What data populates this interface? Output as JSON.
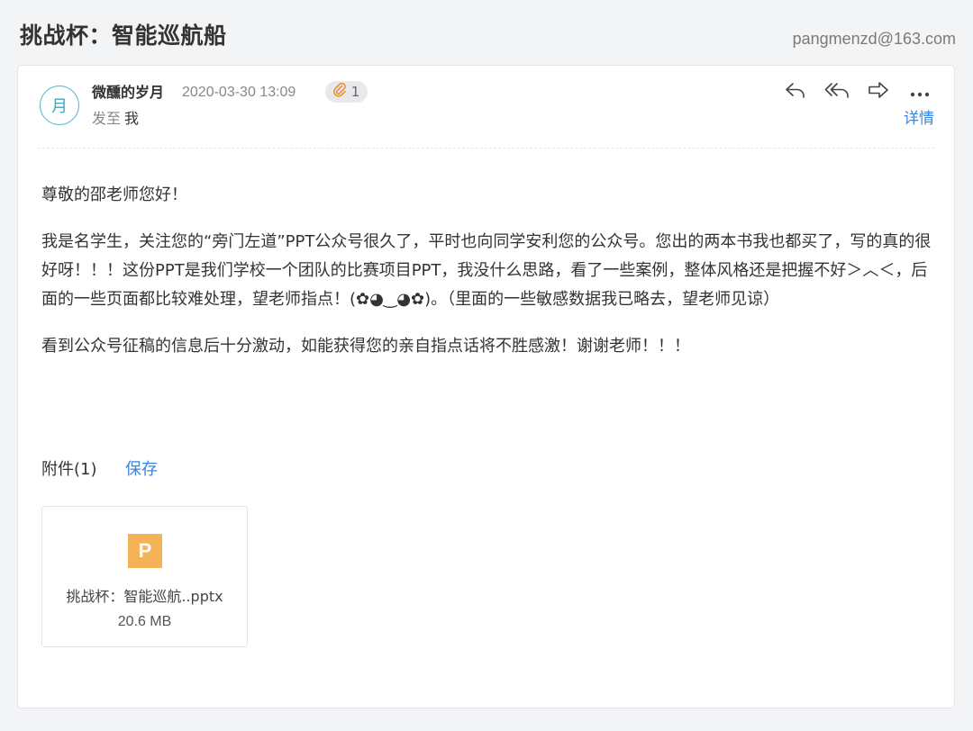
{
  "header": {
    "subject": "挑战杯：智能巡航船",
    "account": "pangmenzd@163.com"
  },
  "message": {
    "avatar_char": "月",
    "sender": "微醺的岁月",
    "date": "2020-03-30 13:09",
    "attachment_count": "1",
    "to_label": "发至",
    "to_value": "我",
    "detail_link": "详情",
    "actions": [
      {
        "name": "reply",
        "icon": "reply-icon"
      },
      {
        "name": "reply-all",
        "icon": "reply-all-icon"
      },
      {
        "name": "forward",
        "icon": "forward-icon"
      },
      {
        "name": "more",
        "icon": "more-icon"
      }
    ]
  },
  "body": {
    "paragraphs": [
      "尊敬的邵老师您好！",
      "我是名学生，关注您的“旁门左道”PPT公众号很久了，平时也向同学安利您的公众号。您出的两本书我也都买了，写的真的很好呀！！！这份PPT是我们学校一个团队的比赛项目PPT，我没什么思路，看了一些案例，整体风格还是把握不好＞︿＜，后面的一些页面都比较难处理，望老师指点！(✿◕‿◕✿)。（里面的一些敏感数据我已略去，望老师见谅）",
      "看到公众号征稿的信息后十分激动，如能获得您的亲自指点话将不胜感激！谢谢老师！！！"
    ]
  },
  "attachments": {
    "heading": "附件(1)",
    "save_label": "保存",
    "files": [
      {
        "icon_letter": "P",
        "name": "挑战杯：智能巡航..pptx",
        "size": "20.6 MB"
      }
    ]
  },
  "colors": {
    "accent_link": "#3c84d9",
    "avatar_ring": "#4fb5c8",
    "ppt_icon": "#f6b256"
  }
}
